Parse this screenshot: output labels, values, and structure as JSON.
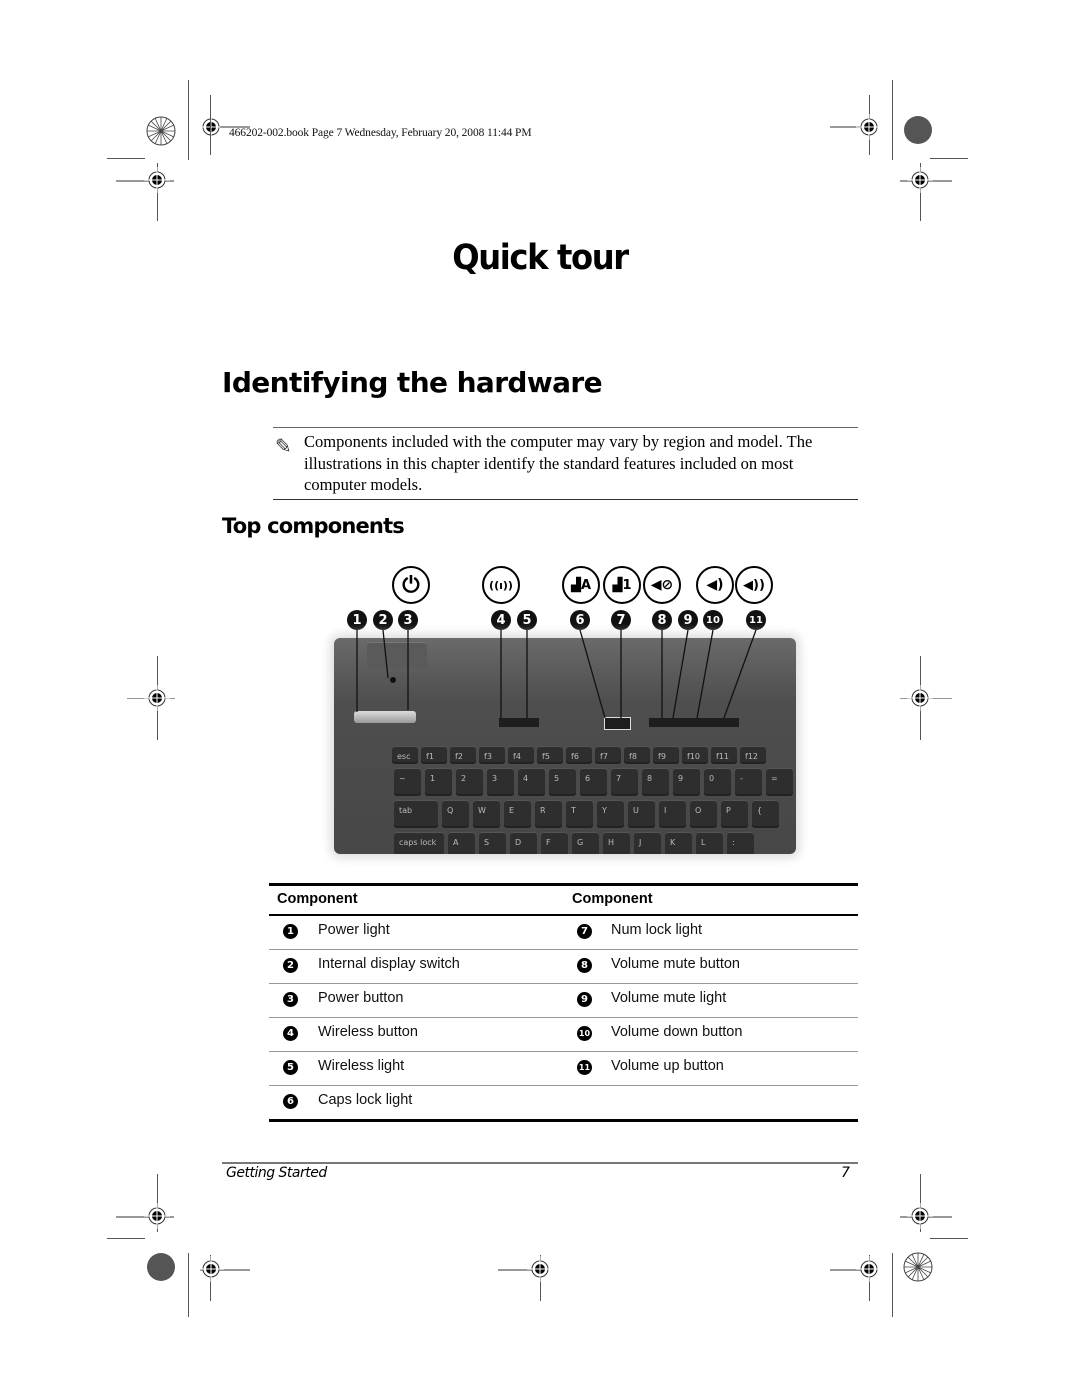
{
  "print_slug": "466202-002.book  Page 7  Wednesday, February 20, 2008  11:44 PM",
  "chapter_title": "Quick tour",
  "section_title": "Identifying the hardware",
  "note": {
    "icon": "pencil-icon",
    "text": "Components included with the computer may vary by region and model. The illustrations in this chapter identify the standard features included on most computer models."
  },
  "subsection_title": "Top components",
  "illustration": {
    "icons": [
      {
        "name": "power-icon",
        "glyph": "⏻"
      },
      {
        "name": "wireless-icon",
        "glyph": "((ı))"
      },
      {
        "name": "caps-lock-icon",
        "glyph": "🔒A"
      },
      {
        "name": "num-lock-icon",
        "glyph": "🔒1"
      },
      {
        "name": "volume-mute-icon",
        "glyph": "🔇"
      },
      {
        "name": "volume-down-icon",
        "glyph": "🔉"
      },
      {
        "name": "volume-up-icon",
        "glyph": "🔊"
      }
    ],
    "callouts": [
      "1",
      "2",
      "3",
      "4",
      "5",
      "6",
      "7",
      "8",
      "9",
      "10",
      "11"
    ],
    "keys_row0": [
      "esc",
      "f1",
      "f2",
      "f3",
      "f4",
      "f5",
      "f6",
      "f7",
      "f8",
      "f9",
      "f10",
      "f11",
      "f12"
    ],
    "keys_row1": [
      "~",
      "1",
      "2",
      "3",
      "4",
      "5",
      "6",
      "7",
      "8",
      "9",
      "0",
      "-",
      "="
    ],
    "keys_row2": [
      "tab",
      "Q",
      "W",
      "E",
      "R",
      "T",
      "Y",
      "U",
      "I",
      "O",
      "P",
      "{"
    ],
    "keys_row3": [
      "caps lock",
      "A",
      "S",
      "D",
      "F",
      "G",
      "H",
      "J",
      "K",
      "L",
      ":"
    ]
  },
  "table": {
    "headers": [
      "Component",
      "Component"
    ],
    "left": [
      {
        "num": "1",
        "label": "Power light"
      },
      {
        "num": "2",
        "label": "Internal display switch"
      },
      {
        "num": "3",
        "label": "Power button"
      },
      {
        "num": "4",
        "label": "Wireless button"
      },
      {
        "num": "5",
        "label": "Wireless light"
      },
      {
        "num": "6",
        "label": "Caps lock light"
      }
    ],
    "right": [
      {
        "num": "7",
        "label": "Num lock light"
      },
      {
        "num": "8",
        "label": "Volume mute button"
      },
      {
        "num": "9",
        "label": "Volume mute light"
      },
      {
        "num": "10",
        "label": "Volume down button"
      },
      {
        "num": "11",
        "label": "Volume up button"
      }
    ]
  },
  "footer": {
    "left": "Getting Started",
    "page_number": "7"
  }
}
